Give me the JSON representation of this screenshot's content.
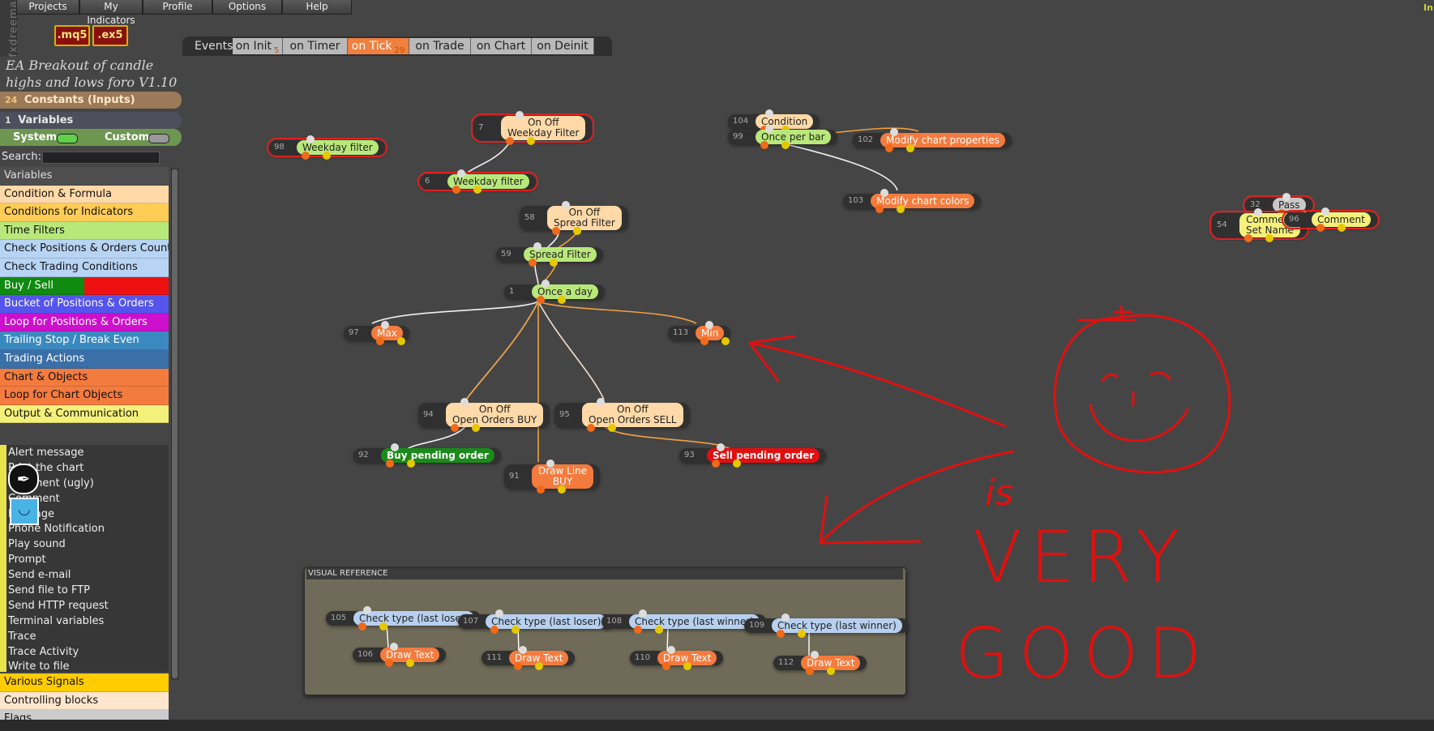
{
  "app": {
    "brand": "fxdreema",
    "top_right": "In"
  },
  "menu": [
    "Projects",
    "My Indicators",
    "Profile",
    "Options",
    "Help"
  ],
  "buttons": {
    "mq5": ".mq5",
    "ex5": ".ex5"
  },
  "project_title": "EA Breakout of candle highs and lows foro V1.10",
  "constants": {
    "count": "24",
    "label": "Constants (Inputs)"
  },
  "variables_bar": {
    "count": "1",
    "label": "Variables"
  },
  "system_custom": {
    "system": "System",
    "custom": "Custom"
  },
  "search": {
    "label": "Search:",
    "placeholder": ""
  },
  "categories": [
    {
      "label": "Variables",
      "color": "#4e4e4e",
      "text": "#ddd"
    },
    {
      "label": "Condition & Formula",
      "color": "#ffd9a8",
      "text": "#111"
    },
    {
      "label": "Conditions for Indicators",
      "color": "#ffcc55",
      "text": "#111"
    },
    {
      "label": "Time Filters",
      "color": "#b9e87a",
      "text": "#111"
    },
    {
      "label": "Check Positions & Orders Count",
      "color": "#b8d4f5",
      "text": "#111"
    },
    {
      "label": "Check Trading Conditions",
      "color": "#b8d4f5",
      "text": "#111"
    },
    {
      "label": "Buy / Sell",
      "color": "#108a10",
      "text": "#fff"
    },
    {
      "label": "Bucket of Positions & Orders",
      "color": "#5555ee",
      "text": "#fff"
    },
    {
      "label": "Loop for Positions & Orders",
      "color": "#cc10cc",
      "text": "#fff"
    },
    {
      "label": "Trailing Stop / Break Even",
      "color": "#3a8ac0",
      "text": "#fff"
    },
    {
      "label": "Trading Actions",
      "color": "#3a6fa8",
      "text": "#fff"
    },
    {
      "label": "Chart & Objects",
      "color": "#f47b3e",
      "text": "#111"
    },
    {
      "label": "Loop for Chart Objects",
      "color": "#f47b3e",
      "text": "#111"
    },
    {
      "label": "Output & Communication",
      "color": "#f5f07a",
      "text": "#111"
    }
  ],
  "output_items": [
    "Alert message",
    "Print the chart",
    "Comment (ugly)",
    "Comment",
    "Message",
    "Phone Notification",
    "Play sound",
    "Prompt",
    "Send e-mail",
    "Send file to FTP",
    "Send HTTP request",
    "Terminal variables",
    "Trace",
    "Trace Activity",
    "Write to file"
  ],
  "categories_bottom": [
    {
      "label": "Various Signals",
      "color": "#ffcc00",
      "text": "#111"
    },
    {
      "label": "Controlling blocks",
      "color": "#ffe6cc",
      "text": "#111"
    },
    {
      "label": "Flags",
      "color": "#cccccc",
      "text": "#111"
    }
  ],
  "events": {
    "label": "Events",
    "tabs": [
      {
        "label": "on Init",
        "count": "5",
        "active": false
      },
      {
        "label": "on Timer",
        "count": "",
        "active": false
      },
      {
        "label": "on Tick",
        "count": "29",
        "active": true
      },
      {
        "label": "on Trade",
        "count": "",
        "active": false
      },
      {
        "label": "on Chart",
        "count": "",
        "active": false
      },
      {
        "label": "on Deinit",
        "count": "",
        "active": false
      }
    ]
  },
  "nodes": [
    {
      "id": "98",
      "label": "Weekday filter",
      "type": "green",
      "selected": true
    },
    {
      "id": "7",
      "label": "On Off\nWeekday Filter",
      "type": "peach",
      "selected": true
    },
    {
      "id": "6",
      "label": "Weekday filter",
      "type": "green",
      "selected": true
    },
    {
      "id": "58",
      "label": "On Off\nSpread Filter",
      "type": "peach"
    },
    {
      "id": "59",
      "label": "Spread Filter",
      "type": "green"
    },
    {
      "id": "1",
      "label": "Once a day",
      "type": "green"
    },
    {
      "id": "97",
      "label": "Max",
      "type": "orange"
    },
    {
      "id": "113",
      "label": "Min",
      "type": "orange"
    },
    {
      "id": "94",
      "label": "On Off\nOpen Orders BUY",
      "type": "peach"
    },
    {
      "id": "95",
      "label": "On Off\nOpen Orders SELL",
      "type": "peach"
    },
    {
      "id": "92",
      "label": "Buy pending order",
      "type": "buy"
    },
    {
      "id": "91",
      "label": "Draw Line\nBUY",
      "type": "orange"
    },
    {
      "id": "93",
      "label": "Sell pending order",
      "type": "sell"
    },
    {
      "id": "104",
      "label": "Condition",
      "type": "peach"
    },
    {
      "id": "99",
      "label": "Once per bar",
      "type": "green"
    },
    {
      "id": "102",
      "label": "Modify chart properties",
      "type": "orange"
    },
    {
      "id": "103",
      "label": "Modify chart colors",
      "type": "orange"
    },
    {
      "id": "32",
      "label": "Pass",
      "type": "gray",
      "selected": true
    },
    {
      "id": "54",
      "label": "Comment\nSet Name",
      "type": "yellow",
      "selected": true
    },
    {
      "id": "96",
      "label": "Comment",
      "type": "yellow",
      "selected": true
    }
  ],
  "visual_reference": {
    "title": "VISUAL REFERENCE",
    "nodes": [
      {
        "id": "105",
        "label": "Check type (last loser)",
        "type": "blue"
      },
      {
        "id": "106",
        "label": "Draw Text",
        "type": "orange"
      },
      {
        "id": "107",
        "label": "Check type (last loser)",
        "type": "blue"
      },
      {
        "id": "111",
        "label": "Draw Text",
        "type": "orange"
      },
      {
        "id": "108",
        "label": "Check type (last winner)",
        "type": "blue"
      },
      {
        "id": "110",
        "label": "Draw Text",
        "type": "orange"
      },
      {
        "id": "109",
        "label": "Check type (last winner)",
        "type": "blue"
      },
      {
        "id": "112",
        "label": "Draw Text",
        "type": "orange"
      }
    ]
  },
  "annotation": {
    "is": "is",
    "very": "VERY",
    "good": "GOOD",
    "color": "#e01010"
  }
}
